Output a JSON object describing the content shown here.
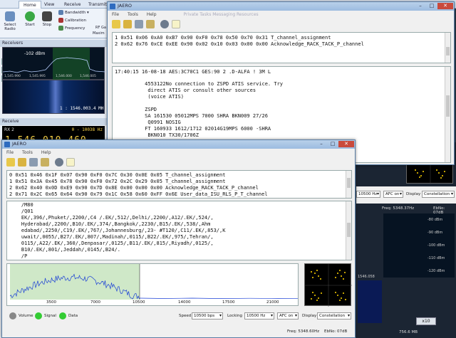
{
  "sdr": {
    "tabs": [
      "Home",
      "View",
      "Receive",
      "Transmit"
    ],
    "active_tab": "Home",
    "ribbon": {
      "select_radio": "Select Radio",
      "start": "Start",
      "stop": "Stop",
      "bandwidth": "Bandwidth",
      "calibration": "Calibration",
      "frequency": "Frequency",
      "rf_gain": "RF Ga",
      "maximize": "Maxim"
    },
    "receivers_label": "Receivers",
    "spectrum_db": "-102 dBm",
    "mini_ticks": [
      "1,545.990",
      "1,545.995",
      "1,546.000",
      "1,546.005"
    ],
    "mini_freq": "1 : 1546.003.4 MH",
    "receive_label": "Receive",
    "rx_name": "RX 2",
    "rx_offset": "0 - 10038 Hz",
    "rx_freq": "1 546 010 460",
    "right_freq": "Freq: 5348.37Hz",
    "right_ebno": "EbNo: 07dB",
    "right_speed": "10500 Hz",
    "right_afc": "AFC on",
    "right_display": "Display",
    "right_mode": "Constellation",
    "right_dbm": [
      "-80 dBm",
      "-90 dBm",
      "-100 dBm",
      "-110 dBm",
      "-120 dBm"
    ],
    "right_wf_freq": "1546.058",
    "right_zoom": "x10",
    "right_bottom_freq": "756.6 MB"
  },
  "jaero_top": {
    "title": "JAERO",
    "menus": [
      "File",
      "Tools",
      "Help"
    ],
    "faint_tabs": "Private Tasks    Messaging    Resources",
    "log_lines": [
      "1 0x51 0x06 0xA0 0xB7 0x90 0xF0 0x78 0x50 0x70 0x31 T_channel_assignment",
      "2 0x62 0x76 0xCE 0xEE 0x90 0x02 0x10 0x03 0x00 0x00 Acknowledge_RACK_TACK_P_channel"
    ],
    "msg_lines": [
      "17:40:15 16-08-18 AES:3C70C1 GES:90 2 .D-ALFA ! 3M L",
      "",
      "          4553122No connection to ZSPD ATIS service. Try",
      "           direct ATIS or consult other sources",
      "           (voice ATIS)",
      "",
      "          ZSPD",
      "          SA 161530 05012MPS 7000 SHRA BKN009 27/26",
      "           Q0991 NOSIG",
      "          FT 160933 1612/1712 02014G19MPS 6000 -SHRA",
      "           BKN010 TX30/1706Z"
    ]
  },
  "jaero_bottom": {
    "title": "JAERO",
    "menus": [
      "File",
      "Tools",
      "Help"
    ],
    "log_lines": [
      "0 0x51 0x46 0x1F 0x07 0x90 0xF0 0x7C 0x30 0x0E 0x05 T_channel_assignment",
      "1 0x51 0x3A 0x45 0x78 0x90 0xF0 0x72 0x2C 0x29 0x05 T_channel_assignment",
      "2 0x62 0x40 0x0D 0xE9 0x90 0x7D 0x8E 0x00 0x00 0x00 Acknowledge_RACK_TACK_P_channel",
      "2 0x71 0x2C 0x65 0x64 0x90 0x79 0x1C 0x58 0x60 0xFF 0x6E User_data_ISU_RLS_P_T_channel"
    ],
    "msg_lines": [
      "    /M80",
      "    /Q01",
      "    EK/,396/,Phuket/,2200/,C4 /.EK/,512/,Delhi/,2200/,A12/.EK/,524/,",
      "    Hyderabad/,2200/,B10/.EK/,374/,Bangkok/,2230/,B15/.EK/,538/,Ahm",
      "    edabad/,2250/,C19/.EK/,767/,Johannesburg/,23- #T120/,C11/.EK/,853/,K",
      "    uwait/,0055/,B27/.EK/,807/,Madinah/,0115/,B22/.EK/,975/,Tehran/,",
      "    0115/,A22/.EK/,360/,Denpasar/,0125/,B11/.EK/,815/,Riyadh/,0125/,",
      "    B10/.EK/,801/,Jeddah/,0145/,B24/.",
      "    /P"
    ],
    "spectrum_ticks": [
      "3500",
      "7000",
      "10500",
      "14000",
      "17500",
      "21000"
    ],
    "leds": {
      "volume": "Volume",
      "signal": "Signal",
      "data": "Data"
    },
    "speed_label": "Speed",
    "speed_value": "10500 bps",
    "locking_label": "Locking",
    "locking_value": "10500 Hz",
    "afc_value": "AFC on",
    "display_label": "Display",
    "display_value": "Constellation",
    "status_freq": "Freq: 5348.60Hz",
    "status_ebno": "EbNo: 07dB",
    "colors": {
      "spectrum_bg": "#ffffff",
      "spectrum_line": "#1a3fd6",
      "band_highlight": "#cfe8c8",
      "led_green": "#33cc33",
      "led_gray": "#888888"
    }
  }
}
